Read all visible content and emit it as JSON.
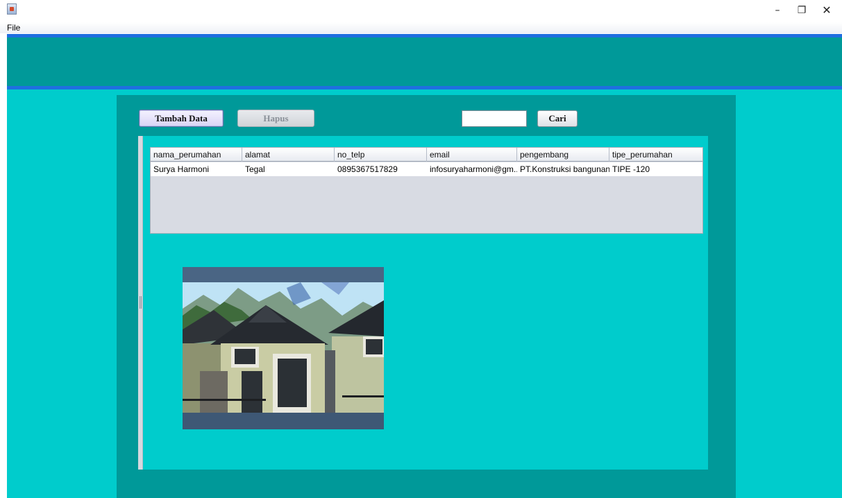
{
  "window": {
    "controls": {
      "minimize": "–",
      "maximize": "❐",
      "close": "✕"
    }
  },
  "menu": {
    "file": "File"
  },
  "toolbar": {
    "add_label": "Tambah Data",
    "delete_label": "Hapus",
    "search_value": "",
    "search_label": "Cari"
  },
  "table": {
    "columns": [
      "nama_perumahan",
      "alamat",
      "no_telp",
      "email",
      "pengembang",
      "tipe_perumahan"
    ],
    "rows": [
      [
        "Surya Harmoni",
        "Tegal",
        "0895367517829",
        "infosuryaharmoni@gm...",
        "PT.Konstruksi bangunan",
        "TIPE -120"
      ]
    ]
  },
  "colors": {
    "banner": "#009999",
    "background": "#00cccc",
    "accent_stripe": "#1f6fe0"
  },
  "icons": [
    "java-app-icon",
    "minimize-icon",
    "maximize-icon",
    "close-icon"
  ]
}
